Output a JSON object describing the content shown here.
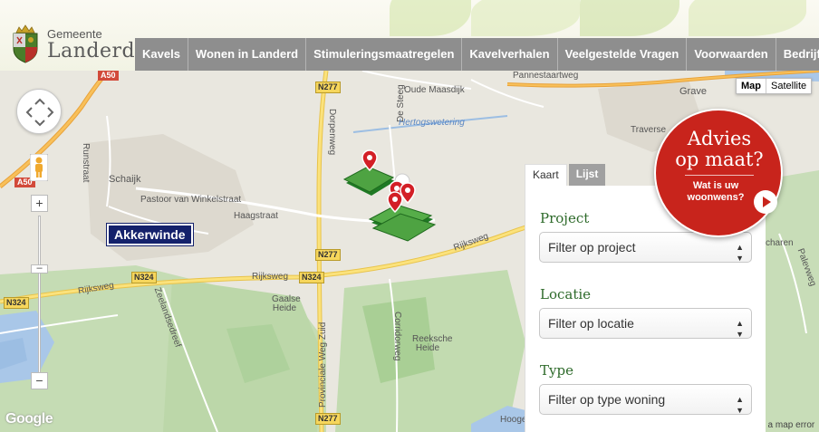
{
  "header": {
    "brand_small": "Gemeente",
    "brand_big": "Landerd",
    "nav": [
      "Kavels",
      "Wonen in Landerd",
      "Stimuleringsmaatregelen",
      "Kavelverhalen",
      "Veelgestelde Vragen",
      "Voorwaarden",
      "Bedrijfslocatie"
    ]
  },
  "map": {
    "type_buttons": [
      "Map",
      "Satellite"
    ],
    "village_tag": "Akkerwinde",
    "google": "Google",
    "map_error": "t a map error",
    "labels": {
      "schaijk": "Schaijk",
      "runstraat": "Runstraat",
      "pastoor": "Pastoor van Winkelstraat",
      "haagstraat": "Haagstraat",
      "rijksweg1": "Rijksweg",
      "rijksweg2": "Rijksweg",
      "rijksweg3": "Rijksweg",
      "dorpenweg": "Dorpenweg",
      "de_steeg": "De Steeg",
      "hertogswetering": "Hertogswetering",
      "oude_maasdijk": "Oude Maasdijk",
      "pannestraat": "Pannestaartweg",
      "grave": "Grave",
      "traverse": "Traverse",
      "gaalse": "Gaalse Heide",
      "reeksche": "Reeksche Heide",
      "corridorweg": "Corridorweg",
      "provinciale": "Provinciale Weg Zuid",
      "zeelandsedreef": "Zeelandsedreef",
      "hooge": "Hooge",
      "charen": "charen",
      "palevweg": "Palevweg"
    },
    "shields": {
      "n277a": "N277",
      "n277b": "N277",
      "n277c": "N277",
      "n324a": "N324",
      "n324b": "N324",
      "n324c": "N324",
      "a50a": "A50",
      "a50b": "A50"
    }
  },
  "filters": {
    "tabs": [
      "Kaart",
      "Lijst"
    ],
    "project_label": "Project",
    "project_value": "Filter op project",
    "locatie_label": "Locatie",
    "locatie_value": "Filter op locatie",
    "type_label": "Type",
    "type_value": "Filter op type woning"
  },
  "badge": {
    "title_line1": "Advies",
    "title_line2": "op maat?",
    "sub_line1": "Wat is uw",
    "sub_line2": "woonwens?"
  },
  "colors": {
    "nav_bg": "#8e8e8e",
    "label_green": "#2d6a2a",
    "badge_red": "#c8241c",
    "village_blue": "#14216b"
  }
}
